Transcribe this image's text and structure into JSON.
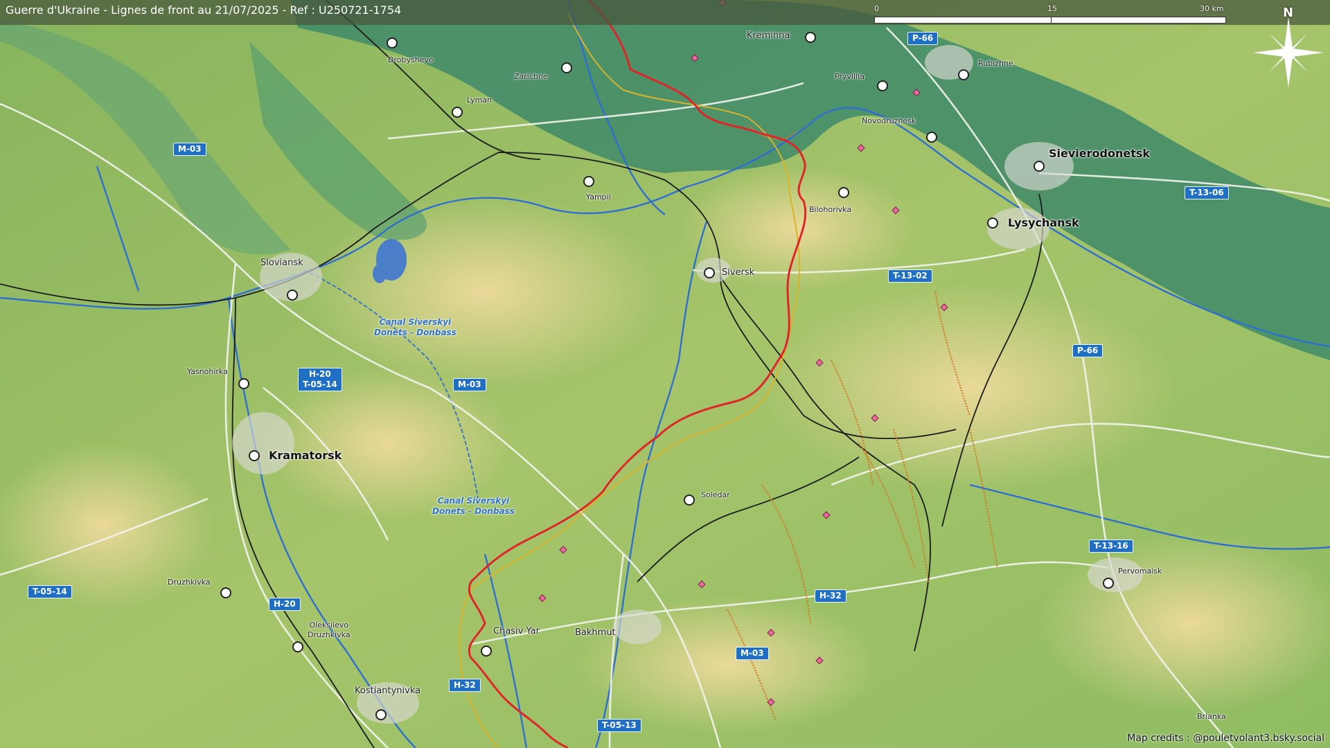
{
  "title": "Guerre d'Ukraine - Lignes de front au 21/07/2025 - Ref : U250721-1754",
  "credits": "Map credits : @pouletvolant3.bsky.social",
  "scale": {
    "labels": [
      "0",
      "15",
      "30 km"
    ]
  },
  "north_label": "N",
  "icons": {
    "north_arrow": "compass-rose-icon",
    "city_marker": "city-circle-icon"
  },
  "colors": {
    "front_line": "#e0252a",
    "previous_line": "#d9b42a",
    "river": "#2f6fd0",
    "road_shield": "#1f6fc4",
    "lowland": "#3f8a6a",
    "upland": "#e4d89a"
  },
  "cities": [
    {
      "name": "Kreminna",
      "size": "normal"
    },
    {
      "name": "Drobysheve",
      "size": "small"
    },
    {
      "name": "Zarichne",
      "size": "small"
    },
    {
      "name": "Lyman",
      "size": "small"
    },
    {
      "name": "Rubizhne",
      "size": "small"
    },
    {
      "name": "Pryvillia",
      "size": "small"
    },
    {
      "name": "Novodruzhesk",
      "size": "small"
    },
    {
      "name": "Sievierodonetsk",
      "size": "big"
    },
    {
      "name": "Yampil",
      "size": "small"
    },
    {
      "name": "Bilohorivka",
      "size": "small"
    },
    {
      "name": "Lysychansk",
      "size": "big"
    },
    {
      "name": "Sloviansk",
      "size": "normal"
    },
    {
      "name": "Siversk",
      "size": "normal"
    },
    {
      "name": "Yasnohirka",
      "size": "small"
    },
    {
      "name": "Kramatorsk",
      "size": "big"
    },
    {
      "name": "Soledar",
      "size": "small"
    },
    {
      "name": "Pervomaisk",
      "size": "small"
    },
    {
      "name": "Druzhkivka",
      "size": "small"
    },
    {
      "name": "Oleksiievo\nDruzhkivka",
      "size": "small"
    },
    {
      "name": "Chasiv Yar",
      "size": "normal"
    },
    {
      "name": "Bakhmut",
      "size": "normal"
    },
    {
      "name": "Kostiantynivka",
      "size": "normal"
    },
    {
      "name": "Brianka",
      "size": "small"
    }
  ],
  "roads": [
    "P-66",
    "M-03",
    "T-13-06",
    "T-13-02",
    "H-20\nT-05-14",
    "M-03",
    "P-66",
    "T-13-16",
    "T-05-14",
    "H-20",
    "H-32",
    "M-03",
    "H-32",
    "T-05-13"
  ],
  "canals": [
    "Canal Siverskyi\nDonets - Donbass",
    "Canal Siverskyi\nDonets - Donbass"
  ]
}
